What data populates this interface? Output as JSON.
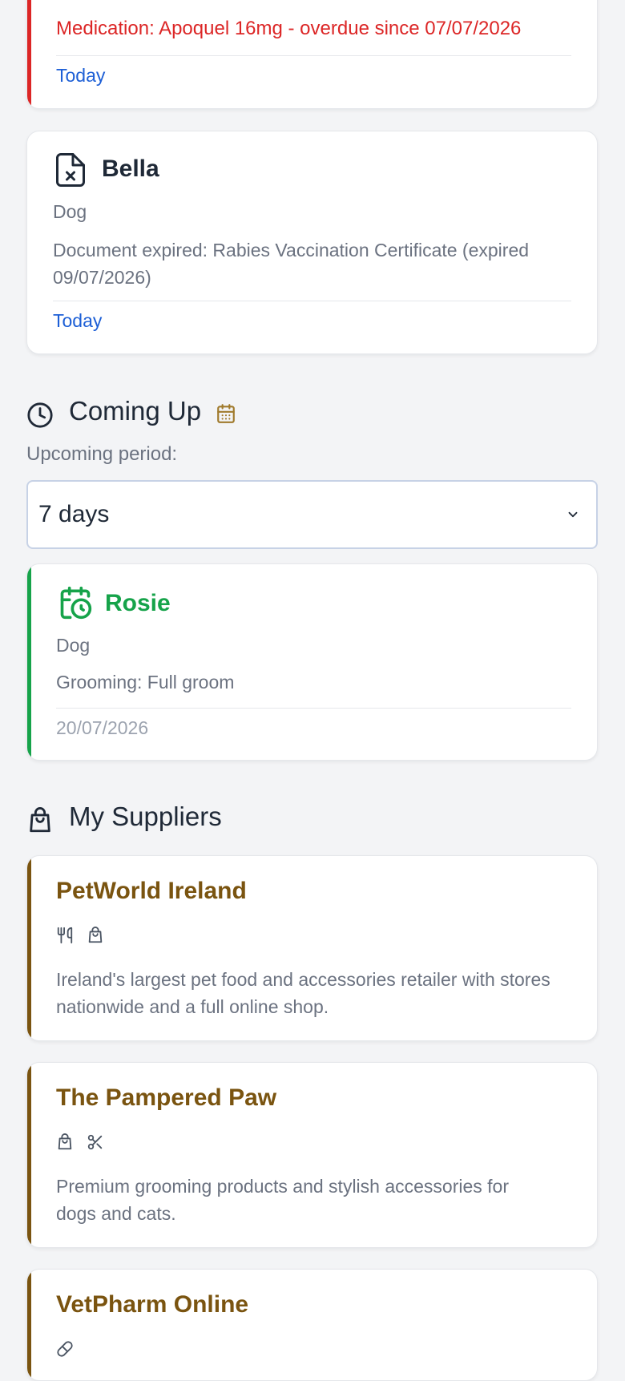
{
  "overdue_card": {
    "message": "Medication: Apoquel 16mg - overdue since 07/07/2026",
    "date_label": "Today",
    "accent_color": "#dc2626"
  },
  "expired_card": {
    "icon": "file-x-icon",
    "pet_name": "Bella",
    "species": "Dog",
    "message": "Document expired: Rabies Vaccination Certificate (expired 09/07/2026)",
    "date_label": "Today"
  },
  "coming_up": {
    "title": "Coming Up",
    "icon": "clock-icon",
    "calendar_icon": "calendar-icon",
    "period_label": "Upcoming period:",
    "period_value": "7 days",
    "items": [
      {
        "icon": "calendar-clock-icon",
        "pet_name": "Rosie",
        "species": "Dog",
        "event": "Grooming: Full groom",
        "date": "20/07/2026",
        "accent_color": "#16a34a"
      }
    ]
  },
  "suppliers": {
    "title": "My Suppliers",
    "icon": "shopping-bag-icon",
    "items": [
      {
        "name": "PetWorld Ireland",
        "tags": [
          "utensils-icon",
          "shopping-bag-icon"
        ],
        "description": "Ireland's largest pet food and accessories retailer with stores nationwide and a full online shop."
      },
      {
        "name": "The Pampered Paw",
        "tags": [
          "shopping-bag-icon",
          "scissors-icon"
        ],
        "description": "Premium grooming products and stylish accessories for dogs and cats."
      },
      {
        "name": "VetPharm Online",
        "tags": [
          "pill-icon"
        ],
        "description": ""
      }
    ],
    "accent_color": "#7a5410"
  }
}
